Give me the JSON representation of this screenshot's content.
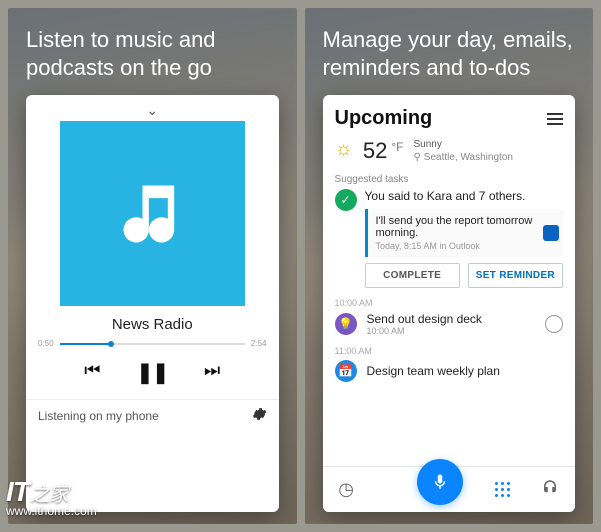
{
  "left": {
    "hero_line1": "Listen to music and",
    "hero_line2": "podcasts on the go",
    "track_title": "News Radio",
    "time_elapsed": "0:50",
    "time_total": "2:54",
    "footer_status": "Listening on my phone"
  },
  "right": {
    "hero_line1": "Manage your day, emails,",
    "hero_line2": "reminders and to-dos",
    "heading": "Upcoming",
    "weather": {
      "temp": "52",
      "unit": "°F",
      "cond": "Sunny",
      "location": "Seattle, Washington"
    },
    "suggested_label": "Suggested tasks",
    "task1": {
      "title": "You said to Kara and 7 others.",
      "quote": "I'll send you the report tomorrow morning.",
      "meta": "Today, 8:15 AM in Outlook",
      "btn_complete": "COMPLETE",
      "btn_remind": "SET REMINDER"
    },
    "slot1_time": "10:00 AM",
    "task2": {
      "title": "Send out design deck",
      "sub": "10:00 AM"
    },
    "slot2_time": "11:00 AM",
    "task3": {
      "title": "Design team weekly plan"
    }
  },
  "watermark": {
    "brand": "IT",
    "brand_suffix": "之家",
    "url": "www.ithome.com"
  }
}
